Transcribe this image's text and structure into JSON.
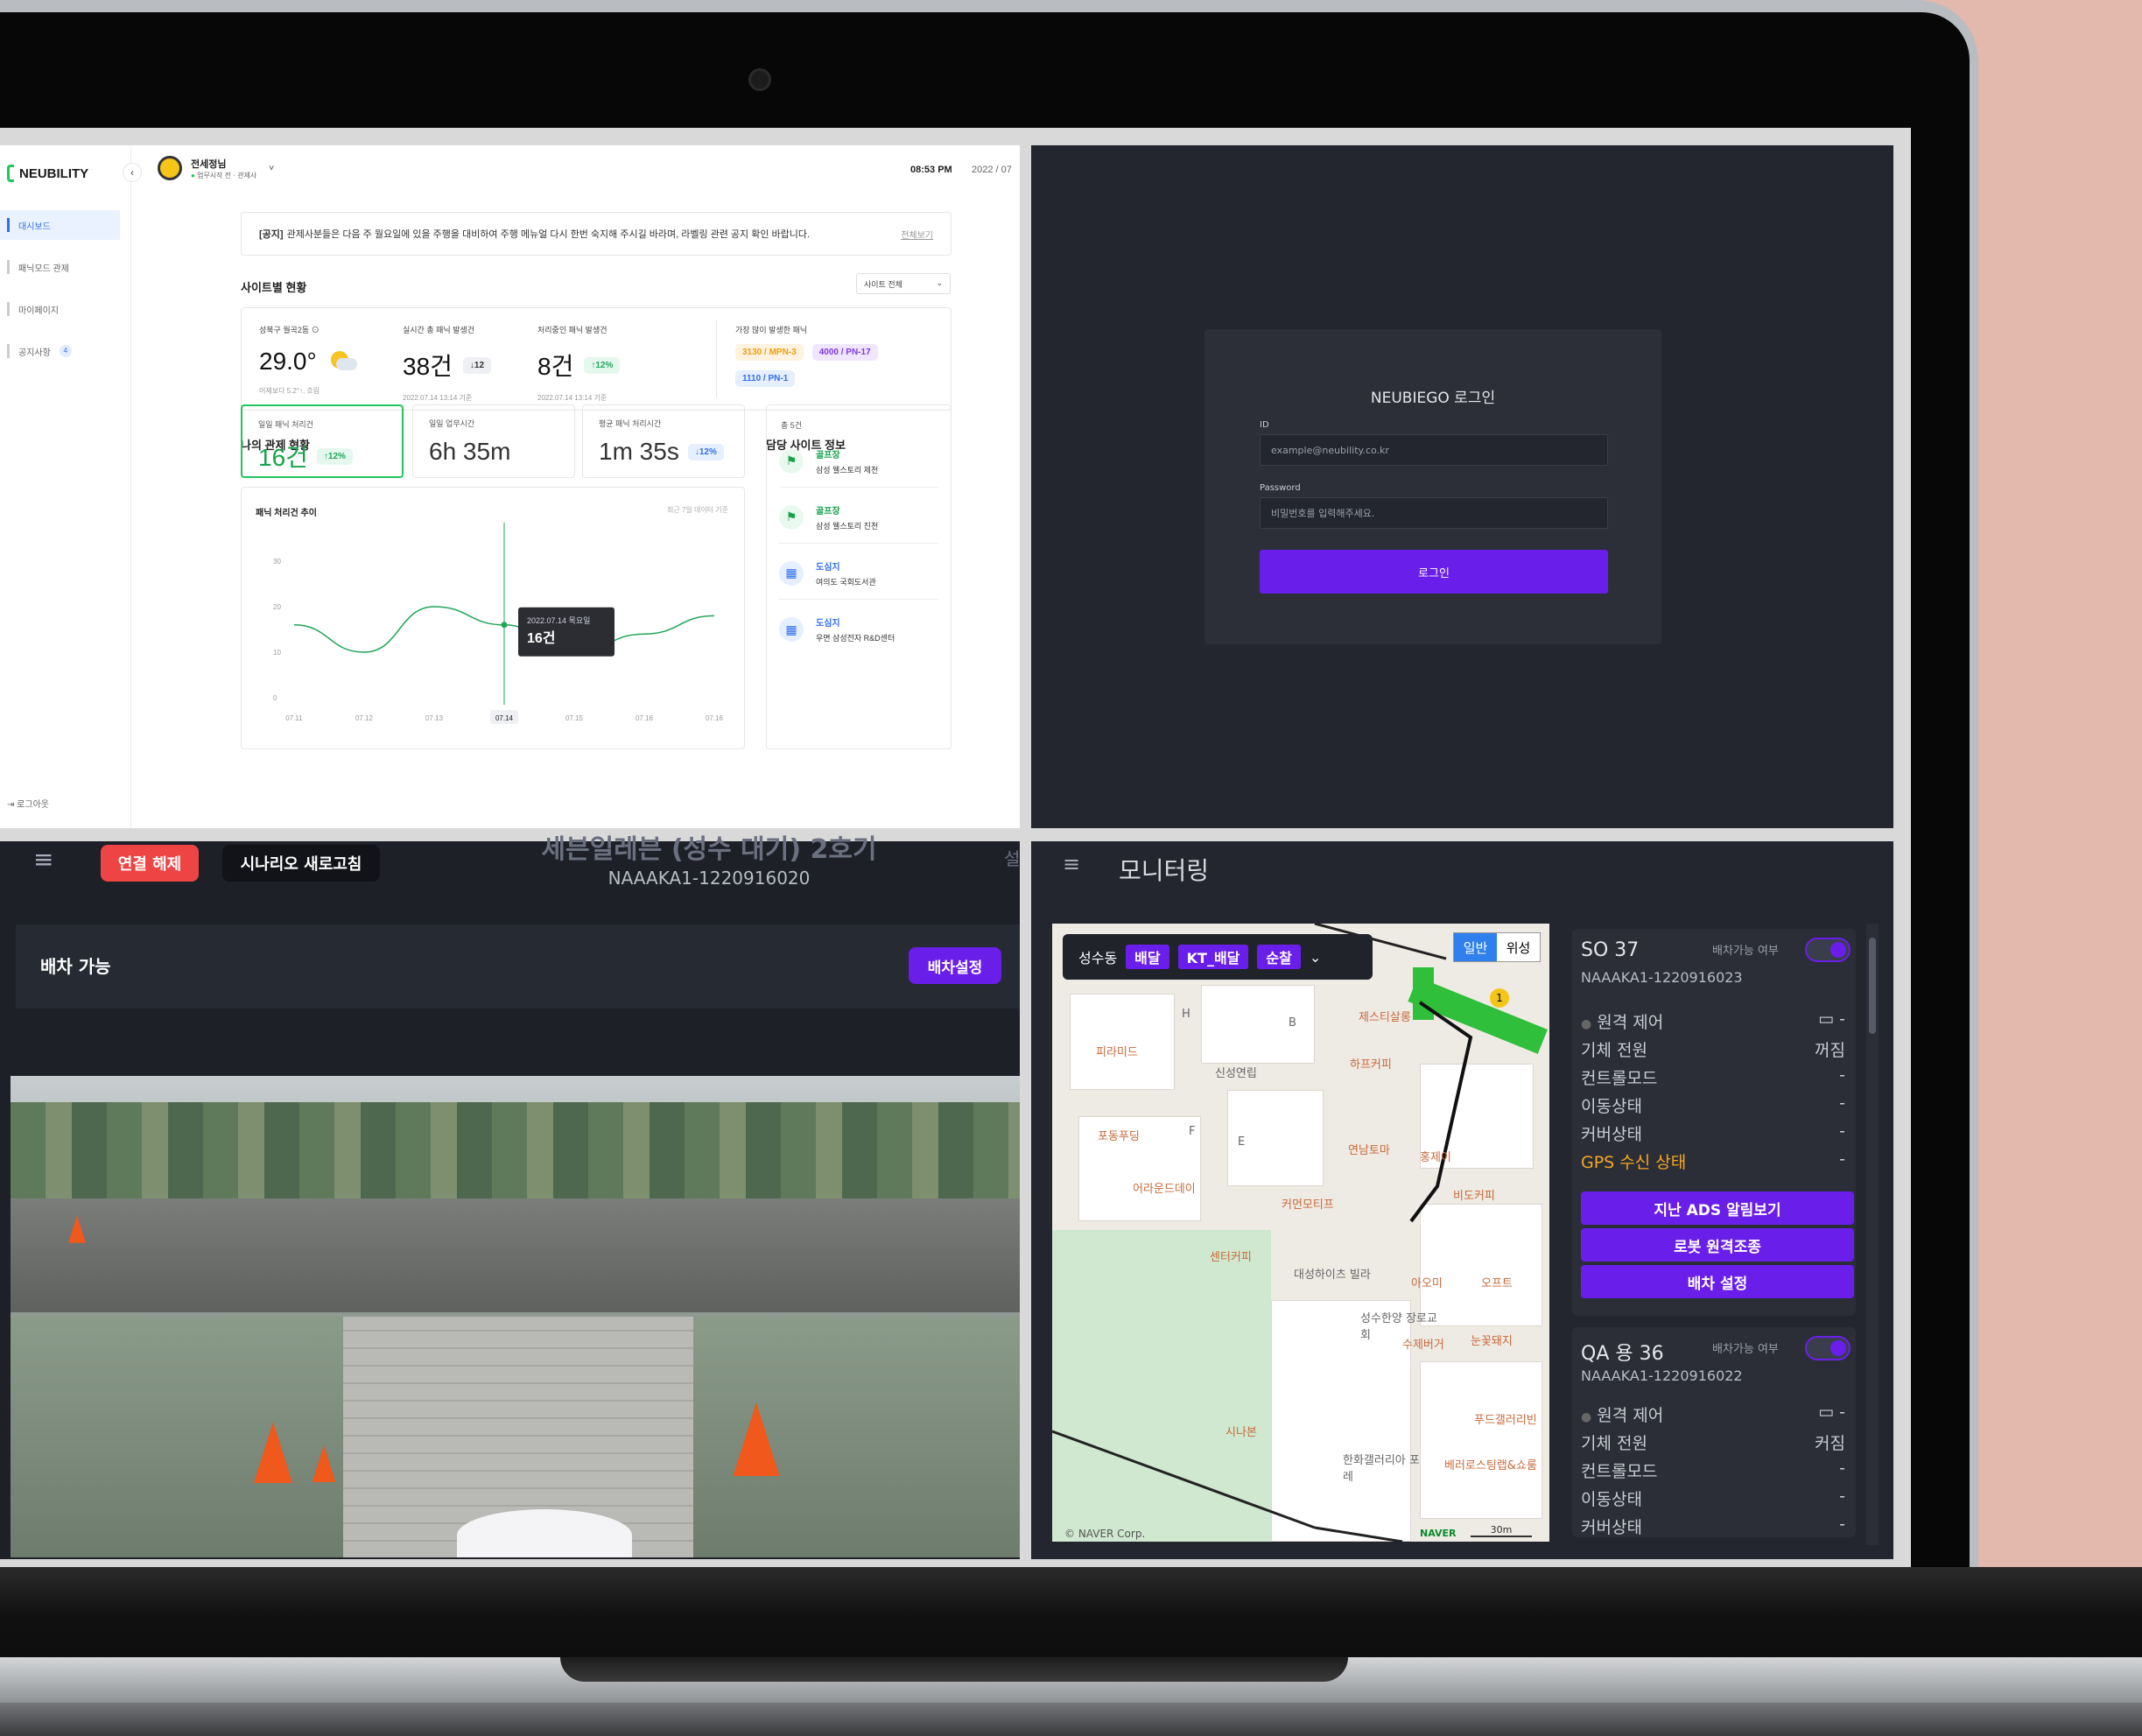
{
  "dashboard": {
    "logo": "NEUBILITY",
    "collapse": "‹",
    "sidebar": [
      {
        "label": "대시보드",
        "active": true
      },
      {
        "label": "패닉모드 관제"
      },
      {
        "label": "마이페이지"
      },
      {
        "label": "공지사항",
        "badge": "4"
      }
    ],
    "logout": "로그아웃",
    "user": {
      "name": "전세정님",
      "status": "업무시작 전 · 관제사",
      "caret": "˅"
    },
    "time": "08:53 PM",
    "date": "2022 / 07",
    "notice": {
      "tag": "[공지]",
      "text": "관제사분들은 다음 주 월요일에 있을 주행을 대비하여 주행 메뉴얼 다시 한번 숙지해 주시길 바라며, 라벨링 관련 공지 확인 바랍니다.",
      "more": "전체보기"
    },
    "site_status_title": "사이트별 현황",
    "site_select": "사이트 전체",
    "site_select_caret": "⌄",
    "weather": {
      "label": "성북구 월곡2동",
      "value": "29.0°",
      "sub": "어제보다 5.2°↑, 흐림"
    },
    "panic_total": {
      "label": "실시간 총 패닉 발생건",
      "value": "38건",
      "chip": "↓12",
      "sub": "2022.07.14 13:14 기준"
    },
    "panic_handling": {
      "label": "처리중인 패닉 발생건",
      "value": "8건",
      "chip": "↑12%",
      "sub": "2022.07.14 13:14 기준"
    },
    "most_panic": {
      "label": "가장 많이 발생한 패닉",
      "chips": [
        "3130 / MPN-3",
        "4000 / PN-17",
        "1110 / PN-1"
      ]
    },
    "my_status_title": "나의 관제 현황",
    "kpis": [
      {
        "label": "일일 패닉 처리건",
        "value": "16건",
        "chip": "↑12%"
      },
      {
        "label": "일일 업무시간",
        "value": "6h 35m"
      },
      {
        "label": "평균 패닉 처리시간",
        "value": "1m 35s",
        "chip": "↓12%"
      }
    ],
    "site_info_title": "담당 사이트 정보",
    "site_total": "총 5건",
    "sites": [
      {
        "type": "골프장",
        "name": "삼성 웰스토리 제천",
        "icon": "flag"
      },
      {
        "type": "골프장",
        "name": "삼성 웰스토리 진천",
        "icon": "flag"
      },
      {
        "type": "도심지",
        "name": "여의도 국회도서관",
        "icon": "building"
      },
      {
        "type": "도심지",
        "name": "우면 삼성전자 R&D센터",
        "icon": "building"
      }
    ],
    "chart_title": "패닉 처리건 추이",
    "chart_note": "최근 7일 데이터 기준",
    "tooltip": {
      "date": "2022.07.14 목요일",
      "value": "16건"
    }
  },
  "chart_data": {
    "type": "line",
    "title": "패닉 처리건 추이",
    "categories": [
      "07.11",
      "07.12",
      "07.13",
      "07.14",
      "07.15",
      "07.16",
      "07.16"
    ],
    "values": [
      16,
      10,
      20,
      16,
      10,
      14,
      18
    ],
    "yticks": [
      0,
      10,
      20,
      30
    ],
    "ylim": [
      0,
      30
    ],
    "highlight": "07.14",
    "color": "#22a559"
  },
  "login": {
    "title": "NEUBIEGO 로그인",
    "id_label": "ID",
    "id_placeholder": "example@neubility.co.kr",
    "pw_label": "Password",
    "pw_placeholder": "비밀번호를 입력해주세요.",
    "button": "로그인"
  },
  "camera": {
    "menu": "≡",
    "disconnect": "연결 해제",
    "refresh": "시나리오 새로고침",
    "title": "세븐일레븐 (성수 대기) 2호기",
    "robot_id": "NAAAKA1-1220916020",
    "cut_label": "설",
    "dispatch_status": "배차 가능",
    "dispatch_button": "배차설정"
  },
  "monitoring": {
    "menu": "≡",
    "title": "모니터링",
    "map": {
      "area": "성수동",
      "tags": [
        "배달",
        "KT_배달",
        "순찰"
      ],
      "chevron": "⌄",
      "mode_normal": "일반",
      "mode_satellite": "위성",
      "copyright": "© NAVER Corp.",
      "logo": "NAVER",
      "scale": "30m",
      "pois": [
        "피라미드",
        "신성연립",
        "하프커피",
        "제스티살롱",
        "포동푸딩",
        "어라운드데이",
        "연남토마",
        "홍제이",
        "커먼모티프",
        "비도커피",
        "센터커피",
        "대성하이츠 빌라",
        "아오미",
        "오프트",
        "성수한양 장로교회",
        "눈꽃돼지",
        "시나본",
        "한화갤러리아 포레",
        "푸드갤러리빈",
        "베러로스팅랩&쇼룸",
        "수제버거",
        "H",
        "B",
        "F",
        "E",
        "1"
      ]
    },
    "robots": [
      {
        "name": "SO 37",
        "avail_label": "배차가능 여부",
        "id": "NAAAKA1-1220916023",
        "props": [
          {
            "k": "원격 제어",
            "v": "▭ -"
          },
          {
            "k": "기체 전원",
            "v": "꺼짐"
          },
          {
            "k": "컨트롤모드",
            "v": "-"
          },
          {
            "k": "이동상태",
            "v": "-"
          },
          {
            "k": "커버상태",
            "v": "-"
          },
          {
            "k": "GPS 수신 상태",
            "v": "-"
          }
        ],
        "buttons": [
          "지난 ADS 알림보기",
          "로봇 원격조종",
          "배차 설정"
        ]
      },
      {
        "name": "QA 용 36",
        "avail_label": "배차가능 여부",
        "id": "NAAAKA1-1220916022",
        "props": [
          {
            "k": "원격 제어",
            "v": "▭ -"
          },
          {
            "k": "기체 전원",
            "v": "커짐"
          },
          {
            "k": "컨트롤모드",
            "v": "-"
          },
          {
            "k": "이동상태",
            "v": "-"
          },
          {
            "k": "커버상태",
            "v": "-"
          }
        ]
      }
    ]
  }
}
